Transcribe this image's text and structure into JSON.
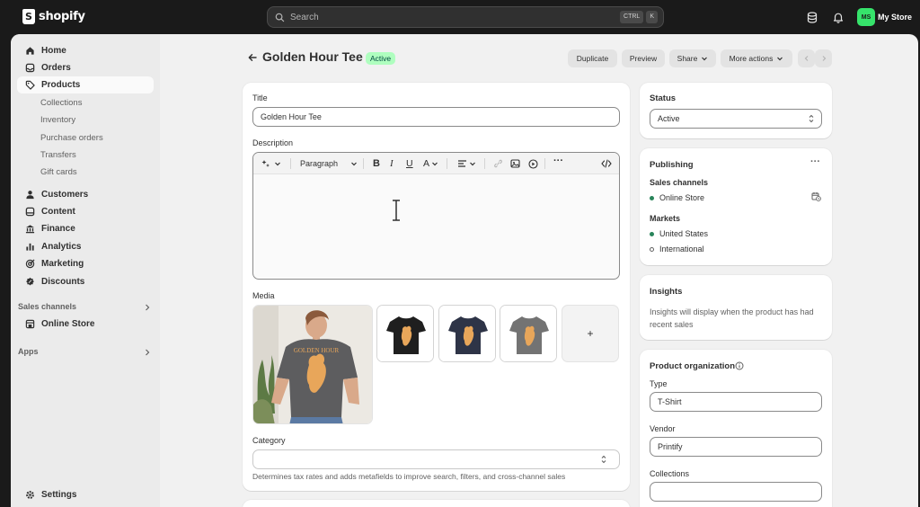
{
  "topbar": {
    "logo_text": "shopify",
    "logo_glyph": "S",
    "search_placeholder": "Search",
    "shortcut_keys": [
      "CTRL",
      "K"
    ],
    "store_initials": "MS",
    "store_name": "My Store"
  },
  "sidebar": {
    "main_items": [
      {
        "label": "Home",
        "icon": "home-icon"
      },
      {
        "label": "Orders",
        "icon": "inbox-icon"
      },
      {
        "label": "Products",
        "icon": "tag-icon"
      }
    ],
    "product_subitems": [
      "Collections",
      "Inventory",
      "Purchase orders",
      "Transfers",
      "Gift cards"
    ],
    "more_items": [
      {
        "label": "Customers",
        "icon": "person-icon"
      },
      {
        "label": "Content",
        "icon": "content-icon"
      },
      {
        "label": "Finance",
        "icon": "bank-icon"
      },
      {
        "label": "Analytics",
        "icon": "bar-chart-icon"
      },
      {
        "label": "Marketing",
        "icon": "target-icon"
      },
      {
        "label": "Discounts",
        "icon": "discount-icon"
      }
    ],
    "sales_channels_label": "Sales channels",
    "online_store_label": "Online Store",
    "apps_label": "Apps",
    "settings_label": "Settings"
  },
  "header": {
    "title": "Golden Hour Tee",
    "status_badge": "Active",
    "buttons": {
      "duplicate": "Duplicate",
      "preview": "Preview",
      "share": "Share",
      "more_actions": "More actions"
    }
  },
  "product_form": {
    "title_label": "Title",
    "title_value": "Golden Hour Tee",
    "description_label": "Description",
    "paragraph_label": "Paragraph",
    "media_label": "Media",
    "add_media_label": "+",
    "shirt_print_text": "GOLDEN HOUR",
    "category_label": "Category",
    "category_help": "Determines tax rates and adds metafields to improve search, filters, and cross-channel sales"
  },
  "status_card": {
    "label": "Status",
    "value": "Active"
  },
  "publishing_card": {
    "title": "Publishing",
    "more": "···",
    "sales_channels_label": "Sales channels",
    "channels": [
      {
        "name": "Online Store",
        "published": true
      }
    ],
    "markets_label": "Markets",
    "markets": [
      {
        "name": "United States",
        "active": true
      },
      {
        "name": "International",
        "active": false
      }
    ]
  },
  "insights_card": {
    "title": "Insights",
    "text": "Insights will display when the product has had recent sales"
  },
  "organization_card": {
    "title": "Product organization",
    "type_label": "Type",
    "type_value": "T-Shirt",
    "vendor_label": "Vendor",
    "vendor_value": "Printify",
    "collections_label": "Collections",
    "collections_value": ""
  },
  "colors": {
    "topbar": "#1a1a1a",
    "active_badge_bg": "#affebf",
    "active_badge_text": "#014b40",
    "published_dot": "#29845a",
    "store_avatar": "#36e36b"
  }
}
